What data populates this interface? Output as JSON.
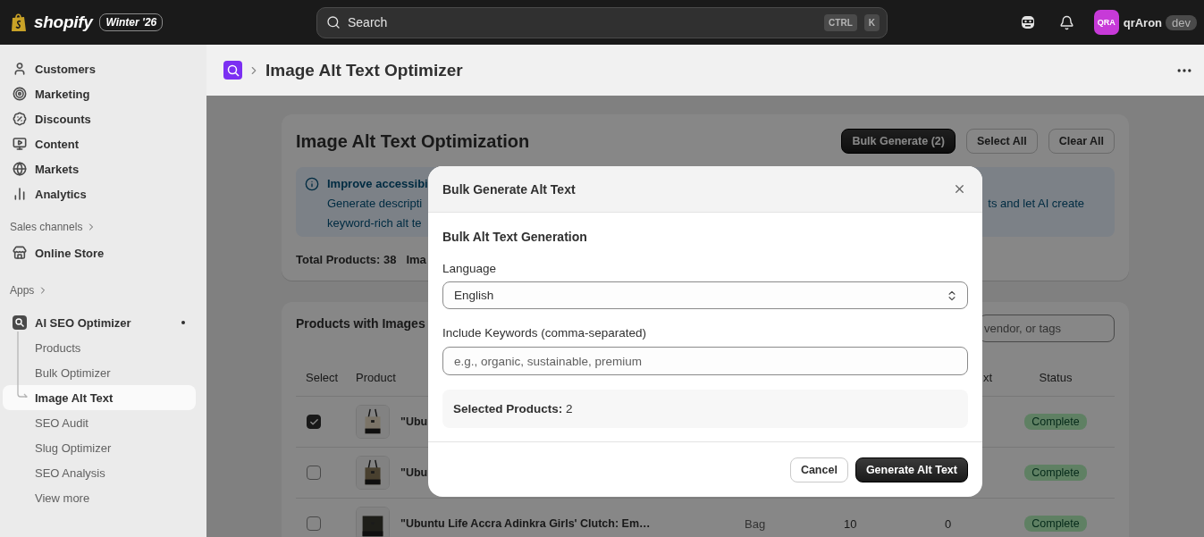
{
  "top_bar": {
    "brand": "shopify",
    "edition": "Winter '26",
    "search": {
      "placeholder": "Search",
      "shortcut": [
        "CTRL",
        "K"
      ]
    },
    "user": {
      "initials": "QRA",
      "name": "qrAron",
      "badge": "dev"
    }
  },
  "sidebar": {
    "items": [
      {
        "label": "Customers"
      },
      {
        "label": "Marketing"
      },
      {
        "label": "Discounts"
      },
      {
        "label": "Content"
      },
      {
        "label": "Markets"
      },
      {
        "label": "Analytics"
      }
    ],
    "sales_channels": {
      "heading": "Sales channels",
      "items": [
        {
          "label": "Online Store"
        }
      ]
    },
    "apps": {
      "heading": "Apps",
      "app": "AI SEO Optimizer",
      "items": [
        {
          "label": "Products",
          "selected": false
        },
        {
          "label": "Bulk Optimizer",
          "selected": false
        },
        {
          "label": "Image Alt Text",
          "selected": true
        },
        {
          "label": "SEO Audit",
          "selected": false
        },
        {
          "label": "Slug Optimizer",
          "selected": false
        },
        {
          "label": "SEO Analysis",
          "selected": false
        }
      ],
      "view_more": "View more"
    }
  },
  "page_header": {
    "title": "Image Alt Text Optimizer"
  },
  "summary_card": {
    "title": "Image Alt Text Optimization",
    "buttons": [
      {
        "label": "Bulk Generate (2)",
        "kind": "primary"
      },
      {
        "label": "Select All",
        "kind": "secondary"
      },
      {
        "label": "Clear All",
        "kind": "secondary"
      }
    ],
    "banner": {
      "title": "Improve accessibi",
      "lines_left": [
        "Generate descripti",
        "keyword-rich alt te"
      ],
      "line_right": "ts and let AI create"
    },
    "stats": [
      "Total Products: 38",
      "Ima"
    ]
  },
  "products_card": {
    "title": "Products with Images",
    "search": {
      "placeholder": "vendor, or tags"
    },
    "columns": {
      "select": "Select",
      "product": "Product",
      "column_5": "xt",
      "status": "Status"
    },
    "rows": [
      {
        "checked": true,
        "name": "\"Ubu",
        "status": "Complete"
      },
      {
        "checked": false,
        "name": "\"Ubu",
        "status": "Complete"
      },
      {
        "checked": false,
        "name": "\"Ubuntu Life Accra Adinkra Girls' Clutch: Em…",
        "column_3": "Bag",
        "column_4": "10",
        "column_5": "0",
        "status": "Complete"
      }
    ]
  },
  "modal": {
    "title": "Bulk Generate Alt Text",
    "section_title": "Bulk Alt Text Generation",
    "language": {
      "label": "Language",
      "value": "English"
    },
    "keywords": {
      "label": "Include Keywords (comma-separated)",
      "placeholder": "e.g., organic, sustainable, premium"
    },
    "summary": "**Selected Products:** 2",
    "buttons": [
      {
        "label": "Cancel",
        "kind": "secondary"
      },
      {
        "label": "Generate Alt Text",
        "kind": "primary"
      }
    ]
  }
}
